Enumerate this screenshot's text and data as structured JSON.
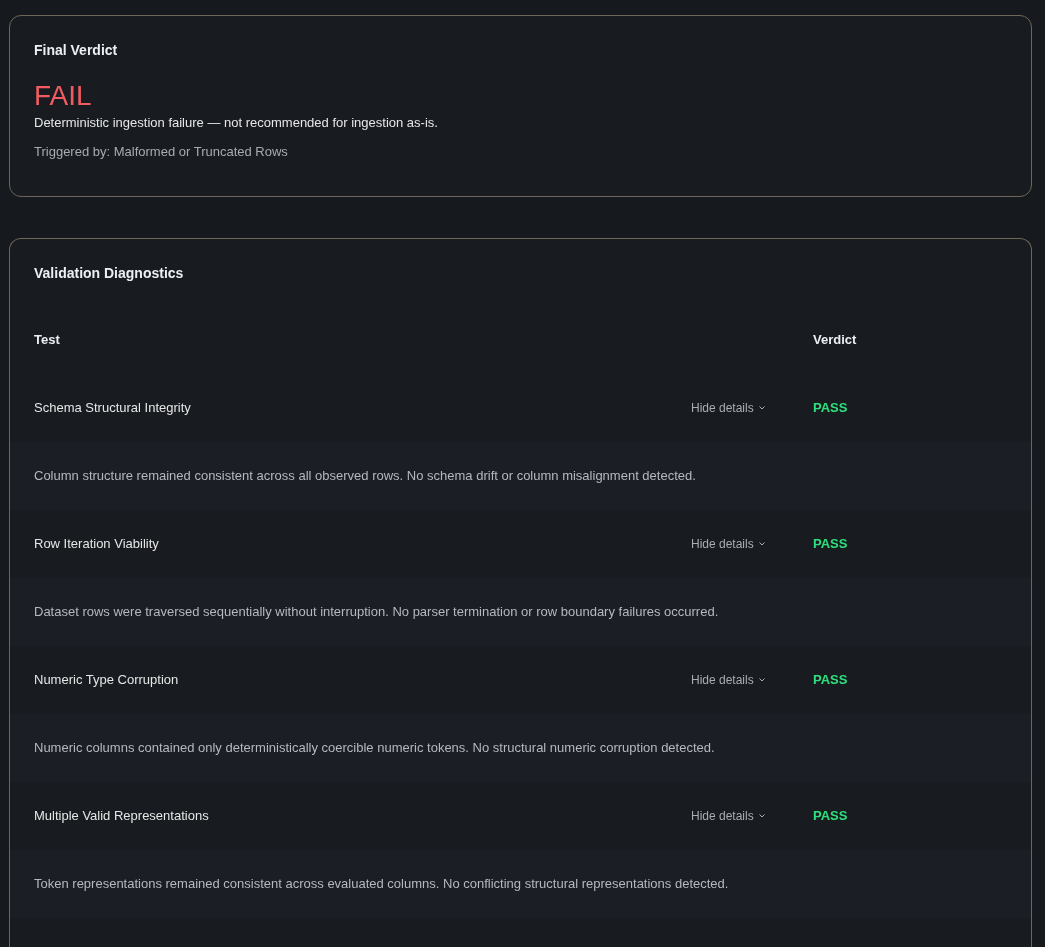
{
  "final_verdict": {
    "title": "Final Verdict",
    "verdict": "FAIL",
    "color": "#f15b61",
    "summary": "Deterministic ingestion failure — not recommended for ingestion as-is.",
    "trigger": "Triggered by: Malformed or Truncated Rows"
  },
  "diagnostics": {
    "title": "Validation Diagnostics",
    "columns": [
      "Test",
      "Verdict"
    ],
    "rows": [
      {
        "test": "Schema Structural Integrity",
        "toggle": "Hide details",
        "expanded": true,
        "verdict": "PASS",
        "color": "#2de07d",
        "details": "Column structure remained consistent across all observed rows. No schema drift or column misalignment detected."
      },
      {
        "test": "Row Iteration Viability",
        "toggle": "Hide details",
        "expanded": true,
        "verdict": "PASS",
        "color": "#2de07d",
        "details": "Dataset rows were traversed sequentially without interruption. No parser termination or row boundary failures occurred."
      },
      {
        "test": "Numeric Type Corruption",
        "toggle": "Hide details",
        "expanded": true,
        "verdict": "PASS",
        "color": "#2de07d",
        "details": "Numeric columns contained only deterministically coercible numeric tokens. No structural numeric corruption detected."
      },
      {
        "test": "Multiple Valid Representations",
        "toggle": "Hide details",
        "expanded": true,
        "verdict": "PASS",
        "color": "#2de07d",
        "details": "Token representations remained consistent across evaluated columns. No conflicting structural representations detected."
      }
    ]
  }
}
